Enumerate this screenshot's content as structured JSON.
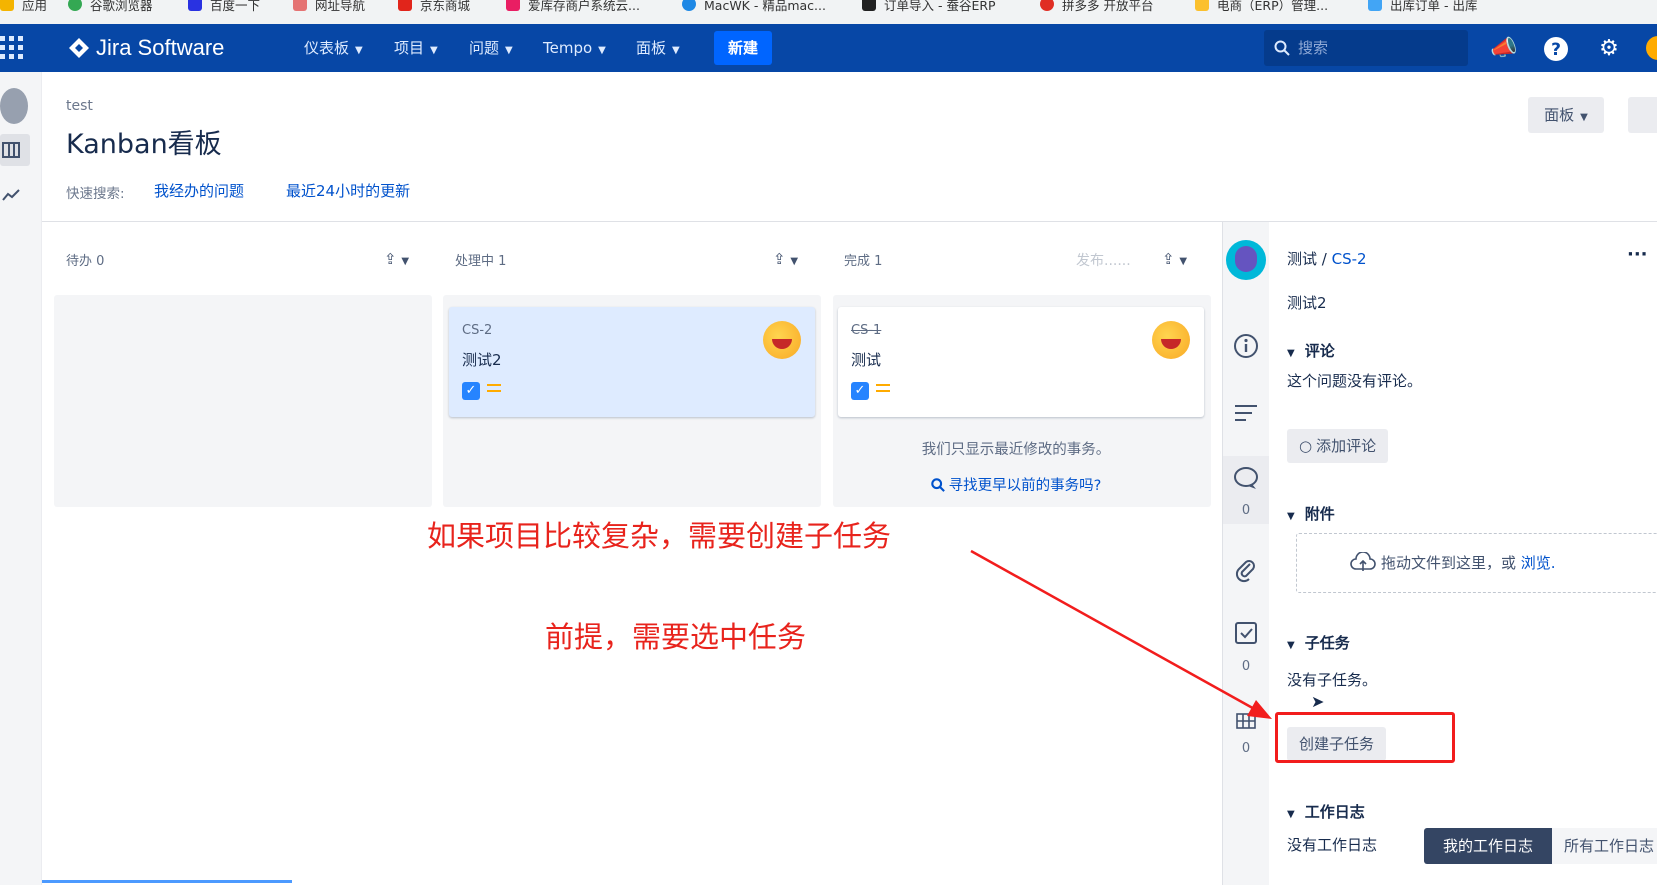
{
  "bookmarks": [
    {
      "label": "应用",
      "color": "#f4b400"
    },
    {
      "label": "谷歌浏览器",
      "color": "#34a853"
    },
    {
      "label": "百度一下",
      "color": "#2932e1"
    },
    {
      "label": "网址导航",
      "color": "#e57373"
    },
    {
      "label": "京东商城",
      "color": "#e1251b"
    },
    {
      "label": "爱库存商户系统云...",
      "color": "#e91e63"
    },
    {
      "label": "MacWK - 精品mac...",
      "color": "#1e88e5"
    },
    {
      "label": "订单导入 - 蚕谷ERP",
      "color": "#212121"
    },
    {
      "label": "拼多多 开放平台",
      "color": "#e02e24"
    },
    {
      "label": "电商（ERP）管理...",
      "color": "#fbc02d"
    },
    {
      "label": "出库订单 - 出库",
      "color": "#42a5f5"
    }
  ],
  "nav": {
    "product": "Jira Software",
    "items": [
      "仪表板",
      "项目",
      "问题",
      "Tempo",
      "面板"
    ],
    "create_label": "新建",
    "search_placeholder": "搜索"
  },
  "header": {
    "project": "test",
    "title": "Kanban看板",
    "quick_label": "快速搜索:",
    "quick_filters": [
      "我经办的问题",
      "最近24小时的更新"
    ],
    "board_button": "面板"
  },
  "columns": [
    {
      "name": "待办 0",
      "extra": ""
    },
    {
      "name": "处理中 1",
      "extra": ""
    },
    {
      "name": "完成 1",
      "extra": "发布......"
    }
  ],
  "cards": [
    {
      "key": "CS-2",
      "summary": "测试2"
    },
    {
      "key": "CS-1",
      "summary": "测试"
    }
  ],
  "done_note": "我们只显示最近修改的事务。",
  "done_link": "寻找更早以前的事务吗?",
  "detail": {
    "breadcrumb_project": "测试 / ",
    "breadcrumb_key": "CS-2",
    "summary": "测试2",
    "comments_title": "评论",
    "no_comments": "这个问题没有评论。",
    "add_comment": "添加评论",
    "attachments_title": "附件",
    "drop_text": "拖动文件到这里，或",
    "browse": "浏览.",
    "subtasks_title": "子任务",
    "no_subtasks": "没有子任务。",
    "create_subtask": "创建子任务",
    "worklog_title": "工作日志",
    "no_worklog": "没有工作日志",
    "tab_mine": "我的工作日志",
    "tab_all": "所有工作日志",
    "counts": [
      "0",
      "0",
      "0"
    ]
  },
  "annotations": {
    "line1": "如果项目比较复杂，需要创建子任务",
    "line2": "前提，需要选中任务",
    "color": "#e8231c"
  }
}
